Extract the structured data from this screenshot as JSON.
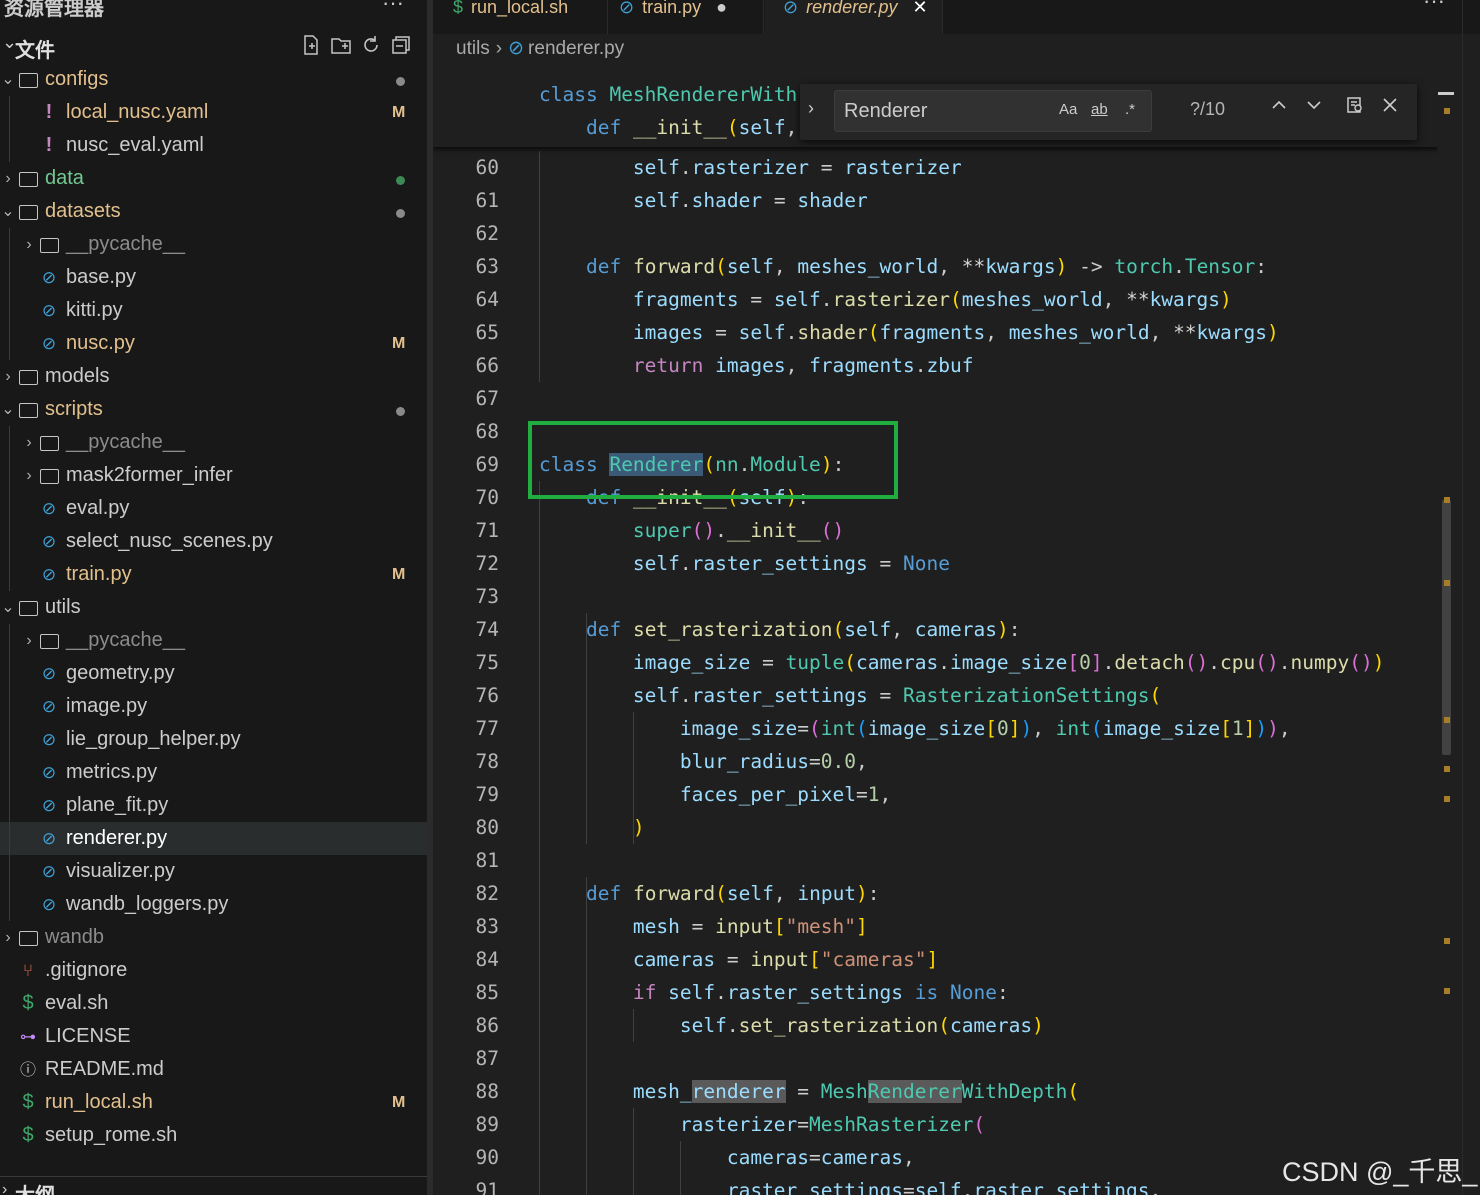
{
  "sidebar": {
    "title": "资源管理器",
    "header_label": "文件",
    "footer_label": "大纲",
    "items": [
      {
        "name": "configs",
        "kind": "folder-open",
        "depth": 0,
        "color": "#e2c08d",
        "dot": "#8a8a8a"
      },
      {
        "name": "local_nusc.yaml",
        "kind": "yaml",
        "depth": 1,
        "color": "#e2c08d",
        "badge": "M"
      },
      {
        "name": "nusc_eval.yaml",
        "kind": "yaml",
        "depth": 1,
        "color": "#cccccc"
      },
      {
        "name": "data",
        "kind": "folder-closed",
        "depth": 0,
        "color": "#73c991",
        "dot": "#3e8a56"
      },
      {
        "name": "datasets",
        "kind": "folder-open",
        "depth": 0,
        "color": "#e2c08d",
        "dot": "#8a8a8a"
      },
      {
        "name": "__pycache__",
        "kind": "folder-closed",
        "depth": 1,
        "color": "#8c8c8c"
      },
      {
        "name": "base.py",
        "kind": "py",
        "depth": 1,
        "color": "#cccccc"
      },
      {
        "name": "kitti.py",
        "kind": "py",
        "depth": 1,
        "color": "#cccccc"
      },
      {
        "name": "nusc.py",
        "kind": "py",
        "depth": 1,
        "color": "#e2c08d",
        "badge": "M"
      },
      {
        "name": "models",
        "kind": "folder-closed",
        "depth": 0,
        "color": "#cccccc"
      },
      {
        "name": "scripts",
        "kind": "folder-open",
        "depth": 0,
        "color": "#e2c08d",
        "dot": "#8a8a8a"
      },
      {
        "name": "__pycache__",
        "kind": "folder-closed",
        "depth": 1,
        "color": "#8c8c8c"
      },
      {
        "name": "mask2former_infer",
        "kind": "folder-closed",
        "depth": 1,
        "color": "#cccccc"
      },
      {
        "name": "eval.py",
        "kind": "py",
        "depth": 1,
        "color": "#cccccc"
      },
      {
        "name": "select_nusc_scenes.py",
        "kind": "py",
        "depth": 1,
        "color": "#cccccc"
      },
      {
        "name": "train.py",
        "kind": "py",
        "depth": 1,
        "color": "#e2c08d",
        "badge": "M"
      },
      {
        "name": "utils",
        "kind": "folder-open",
        "depth": 0,
        "color": "#cccccc"
      },
      {
        "name": "__pycache__",
        "kind": "folder-closed",
        "depth": 1,
        "color": "#8c8c8c"
      },
      {
        "name": "geometry.py",
        "kind": "py",
        "depth": 1,
        "color": "#cccccc"
      },
      {
        "name": "image.py",
        "kind": "py",
        "depth": 1,
        "color": "#cccccc"
      },
      {
        "name": "lie_group_helper.py",
        "kind": "py",
        "depth": 1,
        "color": "#cccccc"
      },
      {
        "name": "metrics.py",
        "kind": "py",
        "depth": 1,
        "color": "#cccccc"
      },
      {
        "name": "plane_fit.py",
        "kind": "py",
        "depth": 1,
        "color": "#cccccc"
      },
      {
        "name": "renderer.py",
        "kind": "py",
        "depth": 1,
        "color": "#ffffff",
        "selected": true
      },
      {
        "name": "visualizer.py",
        "kind": "py",
        "depth": 1,
        "color": "#cccccc"
      },
      {
        "name": "wandb_loggers.py",
        "kind": "py",
        "depth": 1,
        "color": "#cccccc"
      },
      {
        "name": "wandb",
        "kind": "folder-closed",
        "depth": 0,
        "color": "#8c8c8c"
      },
      {
        "name": ".gitignore",
        "kind": "git",
        "depth": 0,
        "color": "#cccccc"
      },
      {
        "name": "eval.sh",
        "kind": "sh",
        "depth": 0,
        "color": "#cccccc"
      },
      {
        "name": "LICENSE",
        "kind": "license",
        "depth": 0,
        "color": "#cccccc"
      },
      {
        "name": "README.md",
        "kind": "info",
        "depth": 0,
        "color": "#cccccc"
      },
      {
        "name": "run_local.sh",
        "kind": "sh",
        "depth": 0,
        "color": "#e2c08d",
        "badge": "M"
      },
      {
        "name": "setup_rome.sh",
        "kind": "sh",
        "depth": 0,
        "color": "#cccccc"
      }
    ]
  },
  "tabs": [
    {
      "label": "run_local.sh",
      "icon": "$",
      "modified": false,
      "active": false
    },
    {
      "label": "train.py",
      "icon": "python-icon",
      "modified": true,
      "active": false
    },
    {
      "label": "renderer.py",
      "icon": "python-icon",
      "modified": false,
      "active": true
    }
  ],
  "breadcrumb": {
    "folder": "utils",
    "file": "renderer.py"
  },
  "find_widget": {
    "query": "Renderer",
    "opt_case": "Aa",
    "opt_word": "ab",
    "opt_regex": ".*",
    "count": "?/10"
  },
  "sticky": [
    {
      "html": "<span class=\"k\">class</span> <span class=\"c\">MeshRendererWith</span>"
    },
    {
      "html": "    <span class=\"k\">def</span> <span class=\"f\">__init__</span><span class=\"b1\">(</span><span class=\"p\">self</span>,"
    }
  ],
  "code": [
    {
      "ln": "60",
      "html": "        <span class=\"p\">self</span>.<span class=\"p\">rasterizer</span> = <span class=\"p\">rasterizer</span>"
    },
    {
      "ln": "61",
      "html": "        <span class=\"p\">self</span>.<span class=\"p\">shader</span> = <span class=\"p\">shader</span>"
    },
    {
      "ln": "62",
      "html": ""
    },
    {
      "ln": "63",
      "html": "    <span class=\"k\">def</span> <span class=\"f\">forward</span><span class=\"b1\">(</span><span class=\"p\">self</span>, <span class=\"p\">meshes_world</span>, <span class=\"o\">**</span><span class=\"p\">kwargs</span><span class=\"b1\">)</span> -> <span class=\"c\">torch</span>.<span class=\"c\">Tensor</span>:"
    },
    {
      "ln": "64",
      "html": "        <span class=\"p\">fragments</span> = <span class=\"p\">self</span>.<span class=\"f\">rasterizer</span><span class=\"b1\">(</span><span class=\"p\">meshes_world</span>, <span class=\"o\">**</span><span class=\"p\">kwargs</span><span class=\"b1\">)</span>"
    },
    {
      "ln": "65",
      "html": "        <span class=\"p\">images</span> = <span class=\"p\">self</span>.<span class=\"f\">shader</span><span class=\"b1\">(</span><span class=\"p\">fragments</span>, <span class=\"p\">meshes_world</span>, <span class=\"o\">**</span><span class=\"p\">kwargs</span><span class=\"b1\">)</span>"
    },
    {
      "ln": "66",
      "html": "        <span class=\"kc\">return</span> <span class=\"p\">images</span>, <span class=\"p\">fragments</span>.<span class=\"p\">zbuf</span>"
    },
    {
      "ln": "67",
      "html": ""
    },
    {
      "ln": "68",
      "html": ""
    },
    {
      "ln": "69",
      "html": "<span class=\"k\">class</span> <span class=\"c hlc\">Renderer</span><span class=\"b1\">(</span><span class=\"c\">nn</span>.<span class=\"c\">Module</span><span class=\"b1\">)</span>:"
    },
    {
      "ln": "70",
      "html": "    <span class=\"k\">def</span> <span class=\"f\">__init__</span><span class=\"b1\">(</span><span class=\"p\">self</span><span class=\"b1\">)</span>:"
    },
    {
      "ln": "71",
      "html": "        <span class=\"c\">super</span><span class=\"b2\">()</span>.<span class=\"f\">__init__</span><span class=\"b2\">()</span>"
    },
    {
      "ln": "72",
      "html": "        <span class=\"p\">self</span>.<span class=\"p\">raster_settings</span> = <span class=\"k\">None</span>"
    },
    {
      "ln": "73",
      "html": ""
    },
    {
      "ln": "74",
      "html": "    <span class=\"k\">def</span> <span class=\"f\">set_rasterization</span><span class=\"b1\">(</span><span class=\"p\">self</span>, <span class=\"p\">cameras</span><span class=\"b1\">)</span>:"
    },
    {
      "ln": "75",
      "html": "        <span class=\"p\">image_size</span> = <span class=\"c\">tuple</span><span class=\"b1\">(</span><span class=\"p\">cameras</span>.<span class=\"p\">image_size</span><span class=\"b2\">[</span><span class=\"n\">0</span><span class=\"b2\">]</span>.<span class=\"f\">detach</span><span class=\"b2\">()</span>.<span class=\"f\">cpu</span><span class=\"b2\">()</span>.<span class=\"f\">numpy</span><span class=\"b2\">()</span><span class=\"b1\">)</span>"
    },
    {
      "ln": "76",
      "html": "        <span class=\"p\">self</span>.<span class=\"p\">raster_settings</span> = <span class=\"c\">RasterizationSettings</span><span class=\"b1\">(</span>"
    },
    {
      "ln": "77",
      "html": "            <span class=\"p\">image_size</span>=<span class=\"b2\">(</span><span class=\"c\">int</span><span class=\"b3\">(</span><span class=\"p\">image_size</span><span class=\"b1\">[</span><span class=\"n\">0</span><span class=\"b1\">]</span><span class=\"b3\">)</span>, <span class=\"c\">int</span><span class=\"b3\">(</span><span class=\"p\">image_size</span><span class=\"b1\">[</span><span class=\"n\">1</span><span class=\"b1\">]</span><span class=\"b3\">)</span><span class=\"b2\">)</span>,"
    },
    {
      "ln": "78",
      "html": "            <span class=\"p\">blur_radius</span>=<span class=\"n\">0.0</span>,"
    },
    {
      "ln": "79",
      "html": "            <span class=\"p\">faces_per_pixel</span>=<span class=\"n\">1</span>,"
    },
    {
      "ln": "80",
      "html": "        <span class=\"b1\">)</span>"
    },
    {
      "ln": "81",
      "html": ""
    },
    {
      "ln": "82",
      "html": "    <span class=\"k\">def</span> <span class=\"f\">forward</span><span class=\"b1\">(</span><span class=\"p\">self</span>, <span class=\"p\">input</span><span class=\"b1\">)</span>:"
    },
    {
      "ln": "83",
      "html": "        <span class=\"p\">mesh</span> = <span class=\"f\">input</span><span class=\"b1\">[</span><span class=\"s\">\"mesh\"</span><span class=\"b1\">]</span>"
    },
    {
      "ln": "84",
      "html": "        <span class=\"p\">cameras</span> = <span class=\"f\">input</span><span class=\"b1\">[</span><span class=\"s\">\"cameras\"</span><span class=\"b1\">]</span>"
    },
    {
      "ln": "85",
      "html": "        <span class=\"kc\">if</span> <span class=\"p\">self</span>.<span class=\"p\">raster_settings</span> <span class=\"k\">is</span> <span class=\"k\">None</span>:"
    },
    {
      "ln": "86",
      "html": "            <span class=\"p\">self</span>.<span class=\"f\">set_rasterization</span><span class=\"b1\">(</span><span class=\"p\">cameras</span><span class=\"b1\">)</span>"
    },
    {
      "ln": "87",
      "html": ""
    },
    {
      "ln": "88",
      "html": "        <span class=\"p\">mesh_</span><span class=\"p hl\">renderer</span> = <span class=\"c\">Mesh</span><span class=\"c hl\">Renderer</span><span class=\"c\">WithDepth</span><span class=\"b1\">(</span>"
    },
    {
      "ln": "89",
      "html": "            <span class=\"p\">rasterizer</span>=<span class=\"c\">MeshRasterizer</span><span class=\"b2\">(</span>"
    },
    {
      "ln": "90",
      "html": "                <span class=\"p\">cameras</span>=<span class=\"p\">cameras</span>,"
    },
    {
      "ln": "91",
      "html": "                <span class=\"p\">raster_settings</span>=<span class=\"p\">self</span>.<span class=\"p\">raster_settings</span>,"
    }
  ],
  "watermark": "CSDN @_千思_"
}
